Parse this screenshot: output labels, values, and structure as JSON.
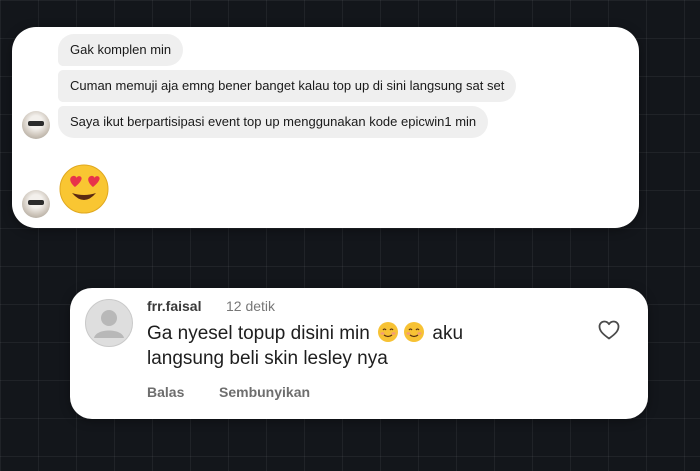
{
  "chat": {
    "messages": [
      {
        "text": "Gak komplen min"
      },
      {
        "text": "Cuman memuji aja emng bener banget kalau top up di sini langsung sat set"
      },
      {
        "text": "Saya ikut berpartisipasi event top up menggunakan kode epicwin1 min"
      }
    ],
    "reaction_icon": "heart-eyes-emoji-icon"
  },
  "comment": {
    "username": "frr.faisal",
    "timestamp": "12 detik",
    "line1": "Ga nyesel topup disini min",
    "line2_tail": "aku",
    "line3": "langsung beli skin lesley nya",
    "reply_label": "Balas",
    "hide_label": "Sembunyikan",
    "like_icon": "heart-outline-icon"
  },
  "colors": {
    "background": "#13161b",
    "card": "#ffffff",
    "bubble": "#efefef"
  }
}
